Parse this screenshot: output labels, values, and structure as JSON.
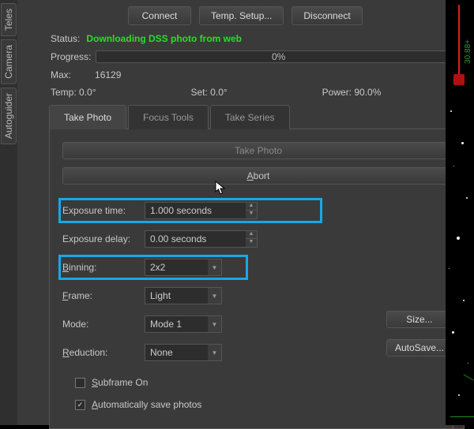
{
  "sideTabs": {
    "t0": "Teles",
    "t1": "Camera",
    "t2": "Autoguider"
  },
  "topButtons": {
    "connect": "Connect",
    "temp": "Temp. Setup...",
    "disconnect": "Disconnect"
  },
  "status": {
    "label": "Status:",
    "value": "Downloading DSS photo from web"
  },
  "progress": {
    "label": "Progress:",
    "text": "0%"
  },
  "max": {
    "label": "Max:",
    "value": "16129"
  },
  "readings": {
    "temp": "Temp: 0.0°",
    "set": "Set: 0.0°",
    "power": "Power: 90.0%"
  },
  "tabs": {
    "takePhoto": "Take Photo",
    "focusTools": "Focus Tools",
    "takeSeries": "Take Series"
  },
  "actions": {
    "takePhoto": "Take Photo",
    "abort": "Abort"
  },
  "form": {
    "exposureTime": {
      "label": "Exposure time:",
      "value": "1.000 seconds"
    },
    "exposureDelay": {
      "label": "Exposure delay:",
      "value": "0.00 seconds"
    },
    "binning": {
      "label": "Binning:",
      "value": "2x2"
    },
    "frame": {
      "label": "Frame:",
      "value": "Light"
    },
    "mode": {
      "label": "Mode:",
      "value": "Mode 1"
    },
    "reduction": {
      "label": "Reduction:",
      "value": "None"
    }
  },
  "checks": {
    "subframe": {
      "label": "Subframe On",
      "checked": false
    },
    "autosave": {
      "label": "Automatically save photos",
      "checked": true
    }
  },
  "rightButtons": {
    "size": "Size...",
    "autosave": "AutoSave..."
  },
  "starText": "30.88+"
}
